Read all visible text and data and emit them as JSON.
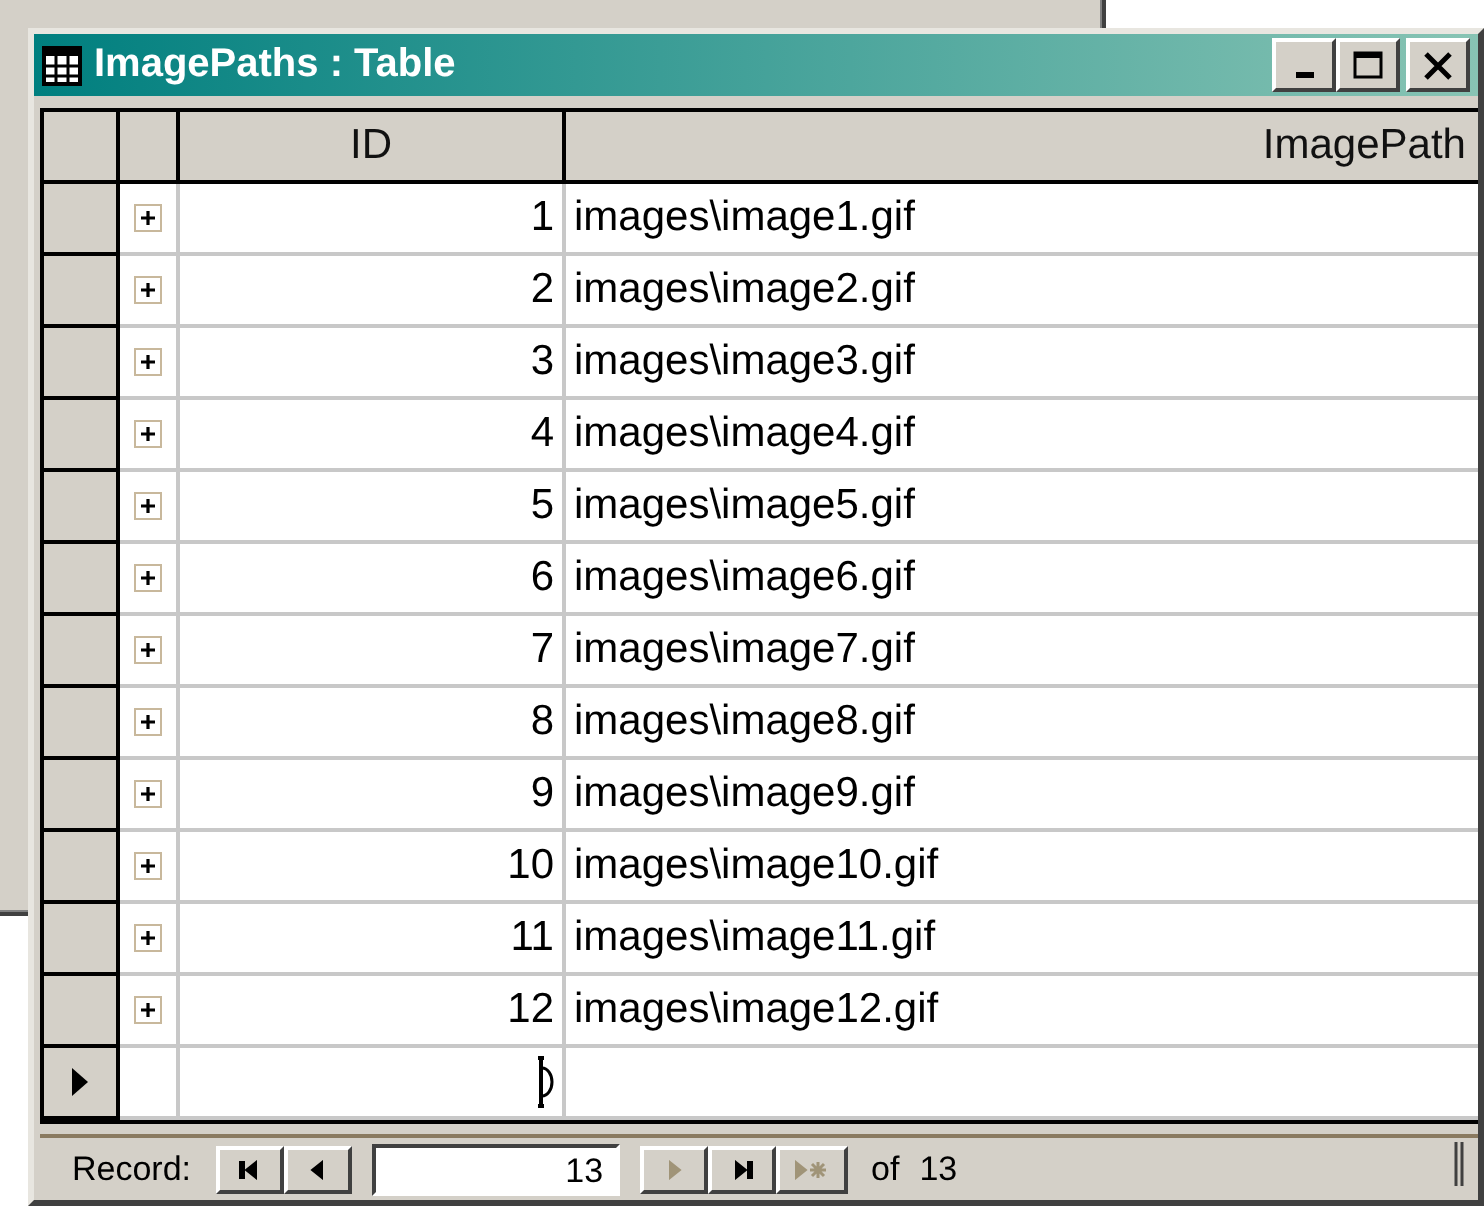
{
  "window": {
    "title": "ImagePaths : Table"
  },
  "table": {
    "columns": [
      "ID",
      "ImagePath"
    ],
    "rows": [
      {
        "id": "1",
        "image_path": "images\\image1.gif",
        "expanded": false,
        "current": false
      },
      {
        "id": "2",
        "image_path": "images\\image2.gif",
        "expanded": false,
        "current": false
      },
      {
        "id": "3",
        "image_path": "images\\image3.gif",
        "expanded": false,
        "current": false
      },
      {
        "id": "4",
        "image_path": "images\\image4.gif",
        "expanded": false,
        "current": false
      },
      {
        "id": "5",
        "image_path": "images\\image5.gif",
        "expanded": false,
        "current": false
      },
      {
        "id": "6",
        "image_path": "images\\image6.gif",
        "expanded": false,
        "current": false
      },
      {
        "id": "7",
        "image_path": "images\\image7.gif",
        "expanded": false,
        "current": false
      },
      {
        "id": "8",
        "image_path": "images\\image8.gif",
        "expanded": false,
        "current": false
      },
      {
        "id": "9",
        "image_path": "images\\image9.gif",
        "expanded": false,
        "current": false
      },
      {
        "id": "10",
        "image_path": "images\\image10.gif",
        "expanded": false,
        "current": false
      },
      {
        "id": "11",
        "image_path": "images\\image11.gif",
        "expanded": false,
        "current": false
      },
      {
        "id": "12",
        "image_path": "images\\image12.gif",
        "expanded": false,
        "current": false
      }
    ],
    "new_row": {
      "current": true
    }
  },
  "navigation": {
    "label": "Record:",
    "buttons_before": [
      {
        "kind": "first",
        "disabled": false
      },
      {
        "kind": "previous",
        "disabled": false
      }
    ],
    "current": "13",
    "buttons_after": [
      {
        "kind": "next",
        "disabled": true
      },
      {
        "kind": "last",
        "disabled": false
      },
      {
        "kind": "new",
        "disabled": true
      }
    ],
    "of_label": "of",
    "total": "13"
  }
}
